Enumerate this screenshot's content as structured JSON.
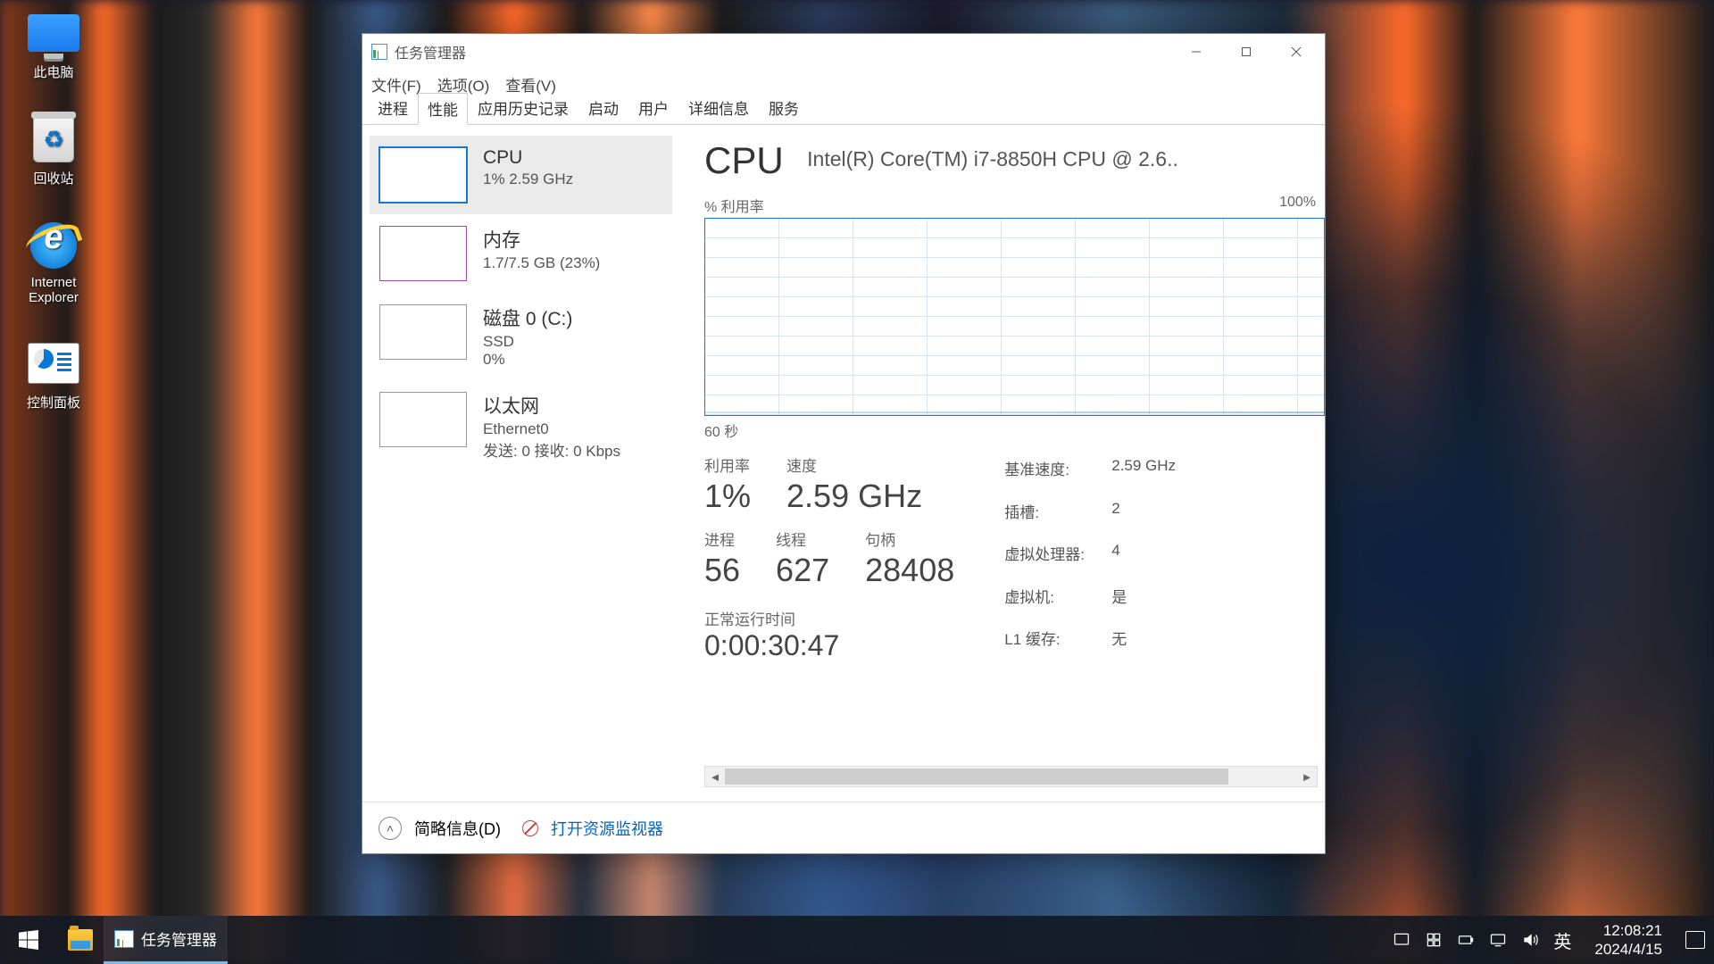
{
  "desktop": {
    "icons": [
      {
        "label": "此电脑"
      },
      {
        "label": "回收站"
      },
      {
        "label": "Internet Explorer"
      },
      {
        "label": "控制面板"
      }
    ]
  },
  "window": {
    "title": "任务管理器",
    "menu": {
      "file": "文件(F)",
      "options": "选项(O)",
      "view": "查看(V)"
    },
    "tabs": [
      "进程",
      "性能",
      "应用历史记录",
      "启动",
      "用户",
      "详细信息",
      "服务"
    ],
    "active_tab": "性能"
  },
  "sidebar": {
    "items": [
      {
        "title": "CPU",
        "line1": "1%  2.59 GHz",
        "line2": ""
      },
      {
        "title": "内存",
        "line1": "1.7/7.5 GB (23%)",
        "line2": ""
      },
      {
        "title": "磁盘 0 (C:)",
        "line1": "SSD",
        "line2": "0%"
      },
      {
        "title": "以太网",
        "line1": "Ethernet0",
        "line2": "发送: 0  接收: 0 Kbps"
      }
    ]
  },
  "cpu": {
    "heading": "CPU",
    "name": "Intel(R) Core(TM) i7-8850H CPU @ 2.6..",
    "chart_label": "% 利用率",
    "chart_max": "100%",
    "chart_xaxis": "60 秒",
    "util_label": "利用率",
    "util_value": "1%",
    "speed_label": "速度",
    "speed_value": "2.59 GHz",
    "proc_label": "进程",
    "proc_value": "56",
    "threads_label": "线程",
    "threads_value": "627",
    "handles_label": "句柄",
    "handles_value": "28408",
    "uptime_label": "正常运行时间",
    "uptime_value": "0:00:30:47",
    "kv": {
      "base_speed_l": "基准速度:",
      "base_speed_v": "2.59 GHz",
      "sockets_l": "插槽:",
      "sockets_v": "2",
      "logical_l": "虚拟处理器:",
      "logical_v": "4",
      "virt_l": "虚拟机:",
      "virt_v": "是",
      "l1_l": "L1 缓存:",
      "l1_v": "无"
    }
  },
  "footer": {
    "fewer": "简略信息(D)",
    "resmon": "打开资源监视器"
  },
  "taskbar": {
    "running": "任务管理器",
    "ime": "英",
    "time": "12:08:21",
    "date": "2024/4/15"
  },
  "chart_data": {
    "type": "line",
    "title": "% 利用率",
    "xlabel": "60 秒",
    "ylabel": "% 利用率",
    "ylim": [
      0,
      100
    ],
    "x": [
      60,
      55,
      50,
      45,
      40,
      35,
      30,
      25,
      20,
      15,
      10,
      5,
      0
    ],
    "values": [
      1,
      1,
      1,
      1,
      1,
      1,
      1,
      1,
      1,
      1,
      1,
      2,
      1
    ]
  }
}
